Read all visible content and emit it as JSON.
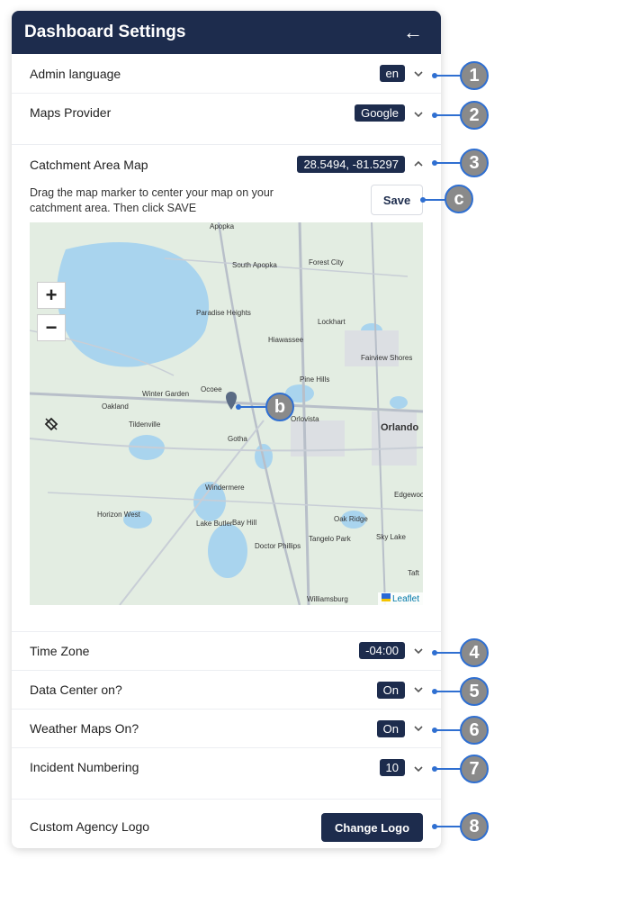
{
  "header": {
    "title": "Dashboard Settings",
    "back_icon": "arrow-left-icon"
  },
  "settings": {
    "admin_language": {
      "label": "Admin language",
      "value": "en"
    },
    "maps_provider": {
      "label": "Maps Provider",
      "value": "Google"
    },
    "catchment": {
      "label": "Catchment Area Map",
      "value": "28.5494, -81.5297",
      "description": "Drag the map marker to center your map on your catchment area. Then click SAVE",
      "save_label": "Save"
    },
    "time_zone": {
      "label": "Time Zone",
      "value": "-04:00"
    },
    "data_center": {
      "label": "Data Center on?",
      "value": "On"
    },
    "weather_maps": {
      "label": "Weather Maps On?",
      "value": "On"
    },
    "incident_numbering": {
      "label": "Incident Numbering",
      "value": "10"
    },
    "custom_logo": {
      "label": "Custom Agency Logo",
      "button": "Change Logo"
    }
  },
  "map": {
    "zoom_in": "+",
    "zoom_out": "−",
    "attribution": "Leaflet",
    "labels": [
      "Apopka",
      "South Apopka",
      "Forest City",
      "Paradise Heights",
      "Lockhart",
      "Hiawassee",
      "Winter Garden",
      "Ocoee",
      "Pine Hills",
      "Oakland",
      "Tildenville",
      "Orlovista",
      "Orlando",
      "Gotha",
      "Windermere",
      "Horizon West",
      "Lake Butler",
      "Bay Hill",
      "Oak Ridge",
      "Doctor Phillips",
      "Tangelo Park",
      "Sky Lake",
      "Edgewood",
      "Fairview Shores",
      "Williamsburg",
      "Taft"
    ]
  },
  "annotations": [
    "1",
    "2",
    "3",
    "c",
    "b",
    "4",
    "5",
    "6",
    "7",
    "8"
  ],
  "colors": {
    "navy": "#1d2c4d",
    "annotation_blue": "#2f6fd1",
    "annotation_gray": "#8a8a8a"
  }
}
